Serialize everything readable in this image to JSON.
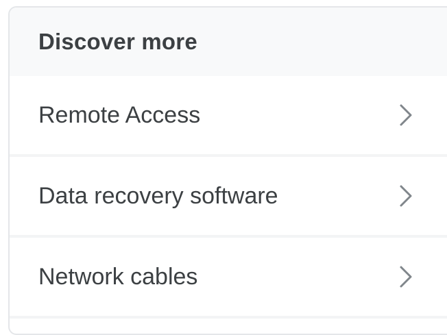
{
  "discover": {
    "title": "Discover more",
    "items": [
      {
        "label": "Remote Access",
        "icon": "chevron-right-icon"
      },
      {
        "label": "Data recovery software",
        "icon": "chevron-right-icon"
      },
      {
        "label": "Network cables",
        "icon": "chevron-right-icon"
      }
    ]
  },
  "colors": {
    "text": "#3c4043",
    "header_bg": "#f8f9fa",
    "chevron": "#80868b",
    "border": "#e4e6e9"
  }
}
